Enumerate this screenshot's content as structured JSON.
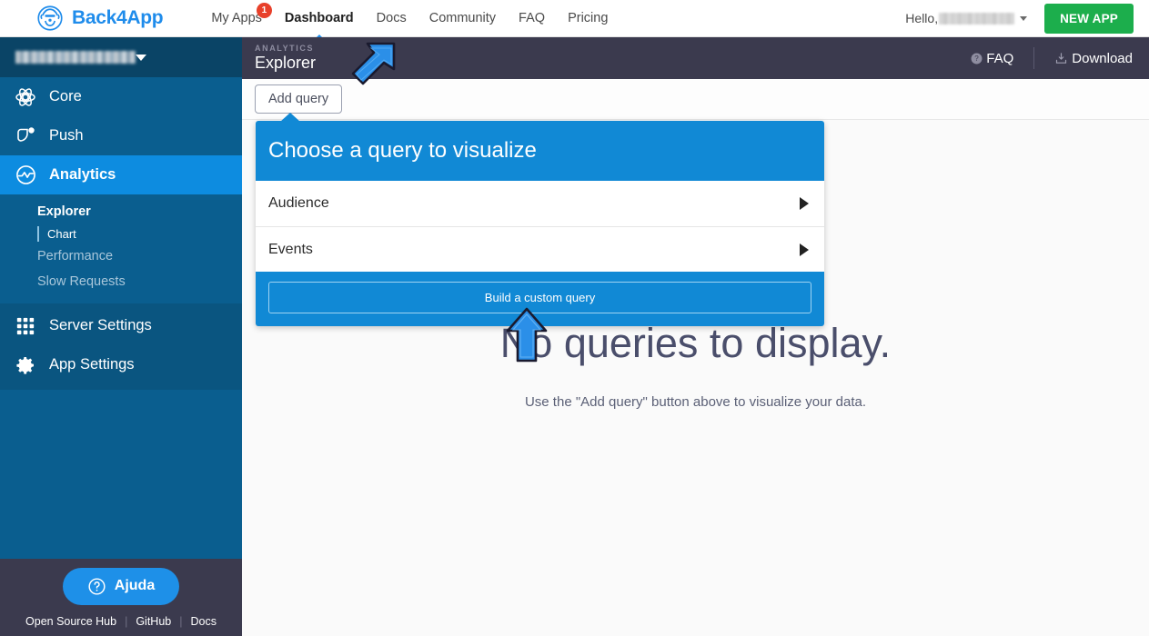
{
  "topnav": {
    "brand": "Back4App",
    "brand_icon": "back4app-logo-icon",
    "links": [
      {
        "label": "My Apps",
        "badge": "1",
        "active": false
      },
      {
        "label": "Dashboard",
        "active": true
      },
      {
        "label": "Docs",
        "active": false
      },
      {
        "label": "Community",
        "active": false
      },
      {
        "label": "FAQ",
        "active": false
      },
      {
        "label": "Pricing",
        "active": false
      }
    ],
    "hello_label": "Hello,",
    "hello_user": "",
    "new_app_label": "NEW APP",
    "accent_green": "#1cae4c",
    "badge_color": "#e8402a",
    "brand_blue": "#1f8ceb"
  },
  "sidebar": {
    "app_name": "",
    "items": [
      {
        "label": "Core",
        "icon": "atom-icon",
        "active": false
      },
      {
        "label": "Push",
        "icon": "push-bell-icon",
        "active": false
      },
      {
        "label": "Analytics",
        "icon": "analytics-wave-icon",
        "active": true
      }
    ],
    "analytics_sub": [
      {
        "label": "Explorer",
        "style": "bold",
        "children": [
          {
            "label": "Chart"
          }
        ]
      },
      {
        "label": "Performance",
        "style": "dim",
        "children": []
      },
      {
        "label": "Slow Requests",
        "style": "dim",
        "children": []
      }
    ],
    "settings_items": [
      {
        "label": "Server Settings",
        "icon": "grid-icon"
      },
      {
        "label": "App Settings",
        "icon": "gear-icon"
      }
    ],
    "help_button": "Ajuda",
    "help_icon": "question-circle-icon",
    "footer_links": [
      "Open Source Hub",
      "GitHub",
      "Docs"
    ],
    "bg_color": "#0a5e8f",
    "active_color": "#0d8ce0",
    "header_color": "#0a4466",
    "footer_color": "#3b3a4e"
  },
  "sub_header": {
    "kicker": "ANALYTICS",
    "title": "Explorer",
    "faq_label": "FAQ",
    "faq_icon": "question-circle-icon",
    "download_label": "Download",
    "download_icon": "download-icon",
    "bg_color": "#3b3a4e"
  },
  "toolbar": {
    "add_query_label": "Add query"
  },
  "query_panel": {
    "title": "Choose a query to visualize",
    "rows": [
      {
        "label": "Audience",
        "arrow_icon": "chevron-right-icon"
      },
      {
        "label": "Events",
        "arrow_icon": "chevron-right-icon"
      }
    ],
    "custom_query_label": "Build a custom query",
    "bg_color": "#1189d5"
  },
  "empty_state": {
    "icon": "analytics-wave-icon",
    "title": "No queries to display.",
    "subtitle": "Use the \"Add query\" button above to visualize your data."
  },
  "annotations": {
    "arrow_color": "#2b8fe8",
    "items": [
      {
        "name": "arrow-pointing-to-add-query",
        "direction": "down-left"
      },
      {
        "name": "arrow-pointing-to-build-custom-query",
        "direction": "up"
      }
    ]
  }
}
